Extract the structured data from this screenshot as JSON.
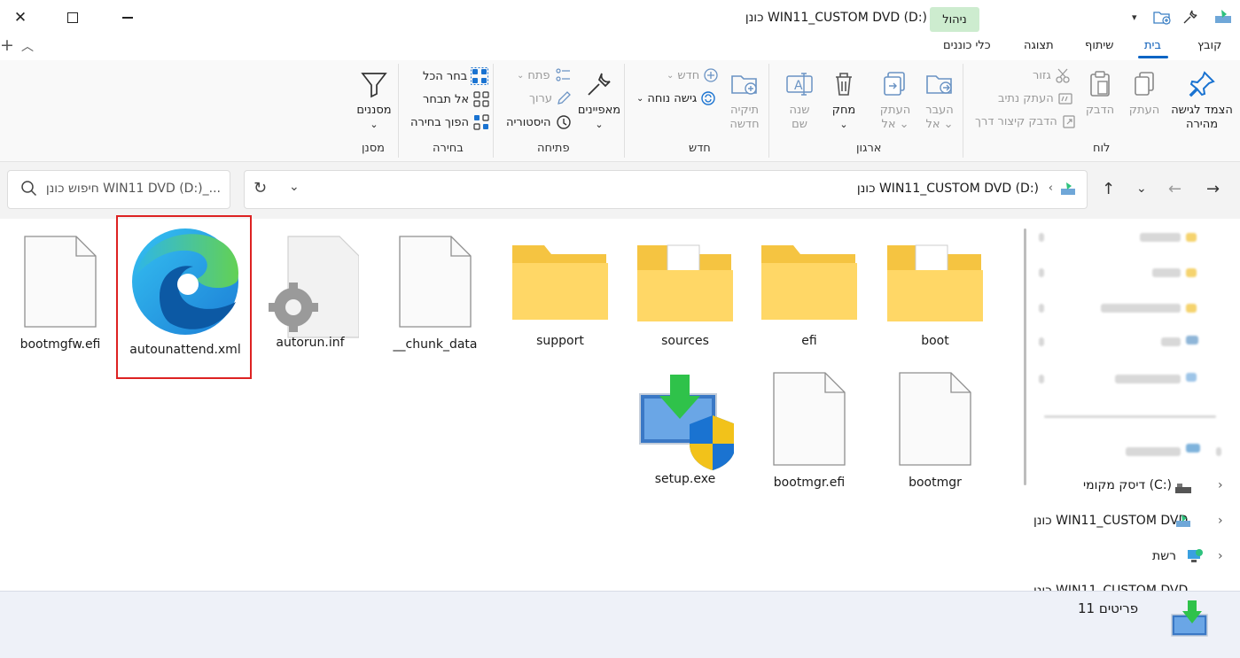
{
  "titlebar": {
    "title": "כונן WIN11_CUSTOM DVD (D:)",
    "manage": "ניהול",
    "close_icon": "close-icon",
    "maximize_icon": "maximize-icon",
    "minimize_icon": "minimize-icon",
    "new_tab": "+",
    "collapse": "^"
  },
  "tabs": [
    "קובץ",
    "בית",
    "שיתוף",
    "תצוגה",
    "כלי כוננים"
  ],
  "ribbon": {
    "clipboard": {
      "label": "לוח",
      "pin": "הצמד לגישה",
      "pin2": "מהירה",
      "copy": "העתק",
      "paste": "הדבק",
      "cut": "גזור",
      "copy_path": "העתק נתיב",
      "paste_shortcut": "הדבק קיצור דרך"
    },
    "organize": {
      "label": "ארגון",
      "move_to": "העבר",
      "move_to2": "אל",
      "copy_to": "העתק",
      "copy_to2": "אל",
      "delete": "מחק",
      "rename": "שנה",
      "rename2": "שם"
    },
    "new": {
      "label": "חדש",
      "new_folder": "תיקיה",
      "new_folder2": "חדשה",
      "new_item": "חדש",
      "easy_access": "גישה נוחה"
    },
    "open": {
      "label": "פתיחה",
      "properties": "מאפיינים",
      "open": "פתח",
      "edit": "ערוך",
      "history": "היסטוריה"
    },
    "select": {
      "label": "בחירה",
      "select_all": "בחר הכל",
      "select_none": "אל תבחר",
      "invert": "הפוך בחירה"
    },
    "filter": {
      "label": "מסנן",
      "filters": "מסננים"
    }
  },
  "address": {
    "path": "כונן WIN11_CUSTOM DVD (D:)",
    "search_placeholder": "חיפוש כונן WIN11 DVD (D:)_..."
  },
  "files": [
    {
      "name": "boot",
      "icon": "folder-with-doc-icon"
    },
    {
      "name": "efi",
      "icon": "folder-icon"
    },
    {
      "name": "sources",
      "icon": "folder-with-doc-icon"
    },
    {
      "name": "support",
      "icon": "folder-icon"
    },
    {
      "name": "__chunk_data",
      "icon": "file-icon"
    },
    {
      "name": "autorun.inf",
      "icon": "settings-file-icon"
    },
    {
      "name": "autounattend.xml",
      "icon": "edge-icon"
    },
    {
      "name": "bootmgfw.efi",
      "icon": "file-icon"
    },
    {
      "name": "bootmgr",
      "icon": "file-icon"
    },
    {
      "name": "bootmgr.efi",
      "icon": "file-icon"
    },
    {
      "name": "setup.exe",
      "icon": "setup-icon"
    }
  ],
  "sidebar": {
    "local_disk": "דיסק מקומי (C:)",
    "dvd": "כונן WIN11_CUSTOM DVD",
    "network": "רשת",
    "dvd_expanded": "כונן WIN11_CUSTOM DVD"
  },
  "status": {
    "count": "11 פריטים"
  }
}
